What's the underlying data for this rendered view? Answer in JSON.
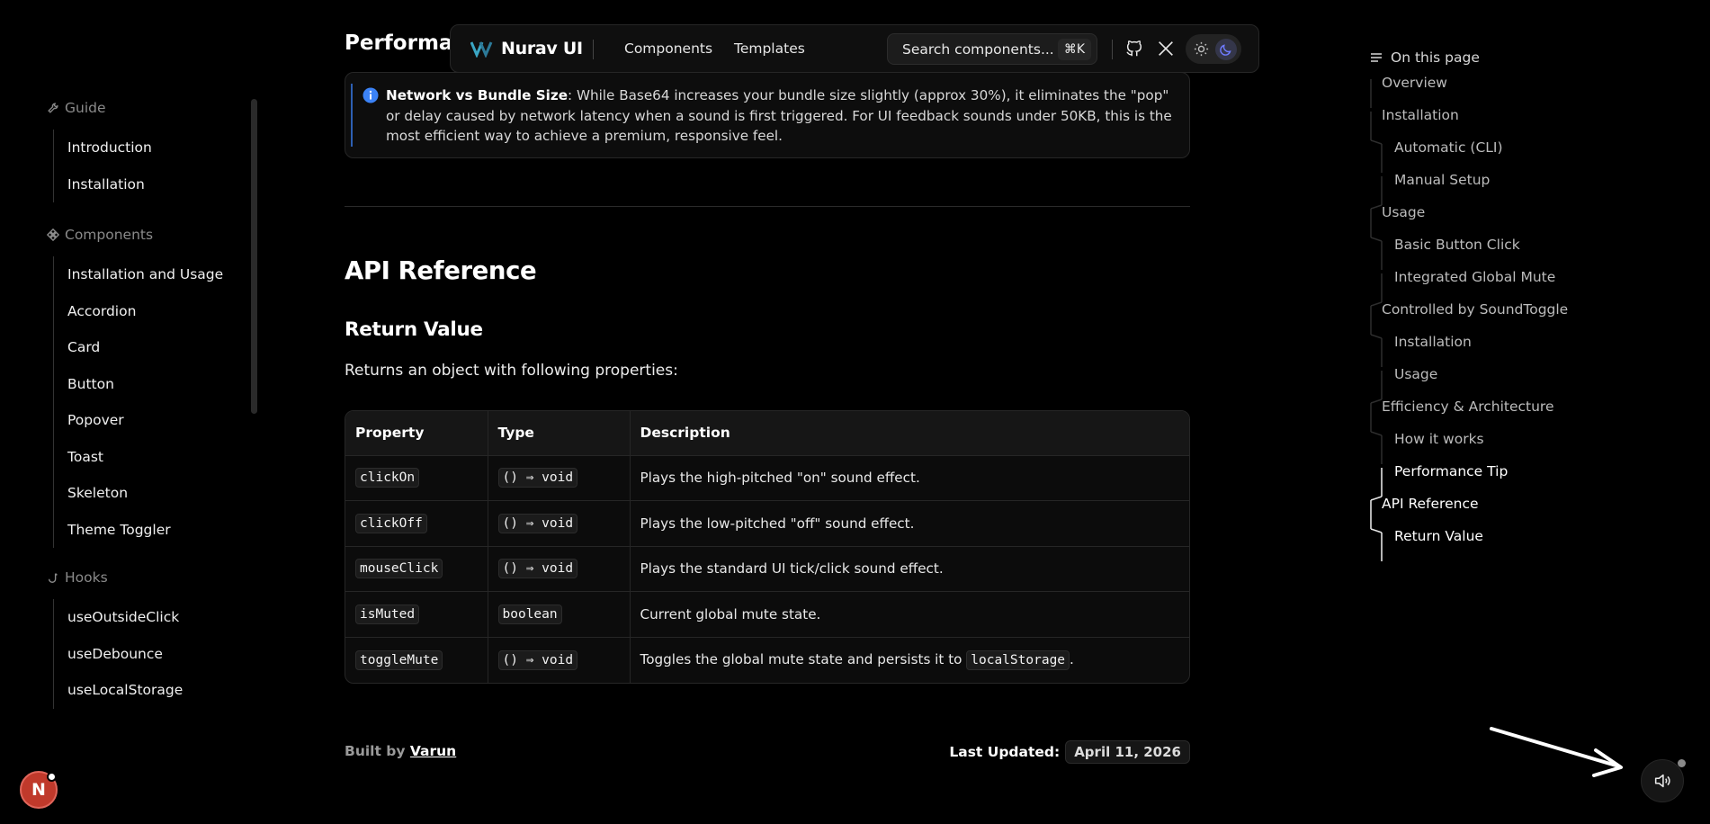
{
  "sidebar": {
    "sections": [
      {
        "heading": "Guide",
        "icon": "wrench-icon",
        "items": [
          "Introduction",
          "Installation"
        ]
      },
      {
        "heading": "Components",
        "icon": "components-icon",
        "items": [
          "Installation and Usage",
          "Accordion",
          "Card",
          "Button",
          "Popover",
          "Toast",
          "Skeleton",
          "Theme Toggler"
        ]
      },
      {
        "heading": "Hooks",
        "icon": "hook-icon",
        "items": [
          "useOutsideClick",
          "useDebounce",
          "useLocalStorage"
        ]
      }
    ]
  },
  "topnav": {
    "brand": "Nurav UI",
    "links": [
      "Components",
      "Templates"
    ],
    "search_placeholder": "Search components...",
    "search_shortcut": "⌘K",
    "icons": [
      "github-icon",
      "x-logo-icon",
      "sun-icon",
      "moon-icon"
    ]
  },
  "content": {
    "partial_title": "Performanc",
    "callout": {
      "bold": "Network vs Bundle Size",
      "text": ": While Base64 increases your bundle size slightly (approx 30%), it eliminates the \"pop\" or delay caused by network latency when a sound is first triggered. For UI feedback sounds under 50KB, this is the most efficient way to achieve a premium, responsive feel."
    },
    "api_heading": "API Reference",
    "return_heading": "Return Value",
    "return_desc": "Returns an object with following properties:",
    "table": {
      "headers": [
        "Property",
        "Type",
        "Description"
      ],
      "rows": [
        {
          "property": "clickOn",
          "type": "() ⇒ void",
          "description": "Plays the high-pitched \"on\" sound effect."
        },
        {
          "property": "clickOff",
          "type": "() ⇒ void",
          "description": "Plays the low-pitched \"off\" sound effect."
        },
        {
          "property": "mouseClick",
          "type": "() ⇒ void",
          "description": "Plays the standard UI tick/click sound effect."
        },
        {
          "property": "isMuted",
          "type": "boolean",
          "description": "Current global mute state."
        },
        {
          "property": "toggleMute",
          "type": "() ⇒ void",
          "description": "Toggles the global mute state and persists it to",
          "code": "localStorage",
          "suffix": "."
        }
      ]
    },
    "footer": {
      "built_by": "Built by",
      "author": "Varun",
      "last_updated_label": "Last Updated:",
      "last_updated": "April 11, 2026"
    }
  },
  "toc": {
    "heading": "On this page",
    "items": [
      {
        "label": "Overview",
        "level": 1,
        "active": false
      },
      {
        "label": "Installation",
        "level": 1,
        "active": false
      },
      {
        "label": "Automatic (CLI)",
        "level": 2,
        "active": false
      },
      {
        "label": "Manual Setup",
        "level": 2,
        "active": false
      },
      {
        "label": "Usage",
        "level": 1,
        "active": false
      },
      {
        "label": "Basic Button Click",
        "level": 2,
        "active": false
      },
      {
        "label": "Integrated Global Mute",
        "level": 2,
        "active": false
      },
      {
        "label": "Controlled by SoundToggle",
        "level": 1,
        "active": false
      },
      {
        "label": "Installation",
        "level": 2,
        "active": false
      },
      {
        "label": "Usage",
        "level": 2,
        "active": false
      },
      {
        "label": "Efficiency & Architecture",
        "level": 1,
        "active": false
      },
      {
        "label": "How it works",
        "level": 2,
        "active": false
      },
      {
        "label": "Performance Tip",
        "level": 2,
        "active": true
      },
      {
        "label": "API Reference",
        "level": 1,
        "active": true
      },
      {
        "label": "Return Value",
        "level": 2,
        "active": true
      }
    ]
  },
  "floating": {
    "avatar_letter": "N",
    "sound_button_icon": "speaker-icon"
  },
  "colors": {
    "background": "#000000",
    "accent_blue": "#2d5fb3",
    "avatar_red": "#c0392b"
  }
}
